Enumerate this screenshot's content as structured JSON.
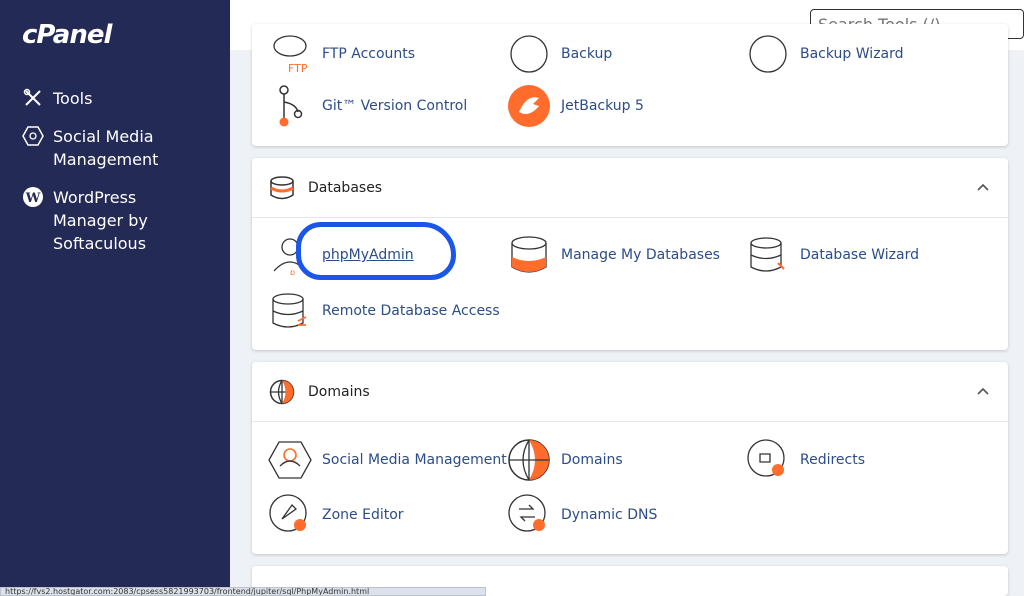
{
  "sidebar": {
    "logo": "cPanel",
    "items": [
      {
        "label": "Tools",
        "icon": "tools-icon"
      },
      {
        "label": "Social Media\nManagement",
        "icon": "social-media-icon"
      },
      {
        "label": "WordPress\nManager by\nSoftaculous",
        "icon": "wordpress-icon"
      }
    ]
  },
  "search": {
    "placeholder": "Search Tools (/)"
  },
  "files_panel": {
    "items": [
      {
        "label": "FTP Accounts"
      },
      {
        "label": "Backup"
      },
      {
        "label": "Backup Wizard"
      },
      {
        "label": "Git™ Version Control"
      },
      {
        "label": "JetBackup 5"
      }
    ]
  },
  "databases_panel": {
    "title": "Databases",
    "items": [
      {
        "label": "phpMyAdmin"
      },
      {
        "label": "Manage My Databases"
      },
      {
        "label": "Database Wizard"
      },
      {
        "label": "Remote Database Access"
      }
    ]
  },
  "domains_panel": {
    "title": "Domains",
    "items": [
      {
        "label": "Social Media Management"
      },
      {
        "label": "Domains"
      },
      {
        "label": "Redirects"
      },
      {
        "label": "Zone Editor"
      },
      {
        "label": "Dynamic DNS"
      }
    ]
  },
  "statusbar": {
    "text": "https://fvs2.hostgator.com:2083/cpsess5821993703/frontend/jupiter/sql/PhpMyAdmin.html"
  },
  "colors": {
    "sidebar": "#232a55",
    "accent": "#ff6c2c",
    "link": "#2c4d87",
    "highlight": "#1a57e8"
  }
}
